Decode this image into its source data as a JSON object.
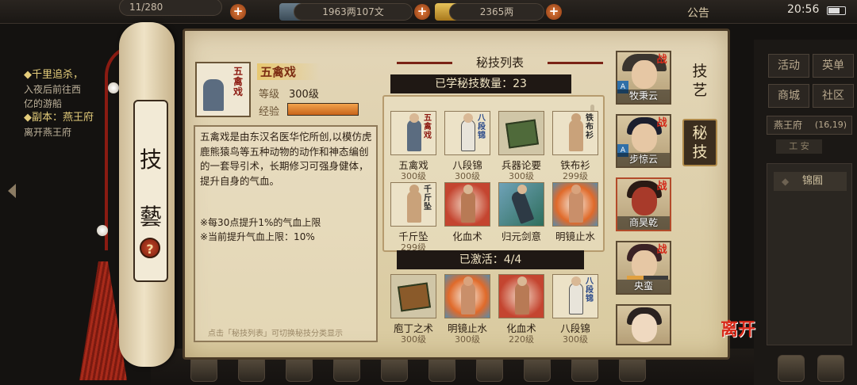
{
  "top_bar": {
    "storage": "11/280",
    "money": "1963两107文",
    "gold": "2365两",
    "notice": "公告",
    "time": "20:56"
  },
  "quest": {
    "line1_title": "◆千里追杀，",
    "line1_text": "入夜后前往西",
    "line1_text2": "亿的游船",
    "line2_title": "◆副本：燕王府",
    "line2_text": "离开燕王府"
  },
  "right_menu": {
    "buttons": [
      "活动",
      "英单",
      "商城",
      "社区"
    ],
    "location": "燕王府",
    "coords": "(16,19)",
    "sub": "工 安",
    "list_item": "锦囿"
  },
  "scroll": {
    "title_top": "技",
    "title_bottom": "藝",
    "help": "?"
  },
  "detail": {
    "name": "五禽戏",
    "level_label": "等级",
    "level_value": "300级",
    "exp_label": "经验",
    "exp_progress": 1.0,
    "description": "五禽戏是由东汉名医华佗所创,以模仿虎鹿熊猿鸟等五种动物的动作和神态编创的一套导引术，长期修习可强身健体，提升自身的气血。",
    "note1": "※每30点提升1%的气血上限",
    "note2": "※当前提升气血上限：10%",
    "tip": "点击「秘技列表」可切换秘技分类显示"
  },
  "book_tabs": {
    "tab1": "技艺",
    "tab2": "秘技"
  },
  "list": {
    "title": "秘技列表",
    "learned": "已学秘技数量：23",
    "activated": "已激活：4/4",
    "learned_skills": [
      {
        "name": "五禽戏",
        "level": "300级",
        "calligraphy": "五禽戏"
      },
      {
        "name": "八段锦",
        "level": "300级",
        "calligraphy": "八段锦"
      },
      {
        "name": "兵器论要",
        "level": "300级",
        "calligraphy": ""
      },
      {
        "name": "铁布衫",
        "level": "299级",
        "calligraphy": "铁布衫"
      },
      {
        "name": "千斤坠",
        "level": "299级",
        "calligraphy": "千斤坠"
      },
      {
        "name": "化血术",
        "level": "",
        "calligraphy": ""
      },
      {
        "name": "归元剑意",
        "level": "",
        "calligraphy": ""
      },
      {
        "name": "明镜止水",
        "level": "",
        "calligraphy": ""
      }
    ],
    "active_skills": [
      {
        "name": "庖丁之术",
        "level": "300级"
      },
      {
        "name": "明镜止水",
        "level": "300级"
      },
      {
        "name": "化血术",
        "level": "220级"
      },
      {
        "name": "八段锦",
        "level": "300级",
        "calligraphy": "八段锦"
      }
    ]
  },
  "portraits": [
    {
      "name": "牧秉云",
      "badge": "战",
      "mark": "A"
    },
    {
      "name": "步惊云",
      "badge": "战",
      "mark": "A"
    },
    {
      "name": "商昊乾",
      "badge": "战",
      "mark": ""
    },
    {
      "name": "央蛮",
      "badge": "战",
      "mark": ""
    },
    {
      "name": "",
      "badge": "",
      "mark": ""
    }
  ],
  "exit": "离开"
}
